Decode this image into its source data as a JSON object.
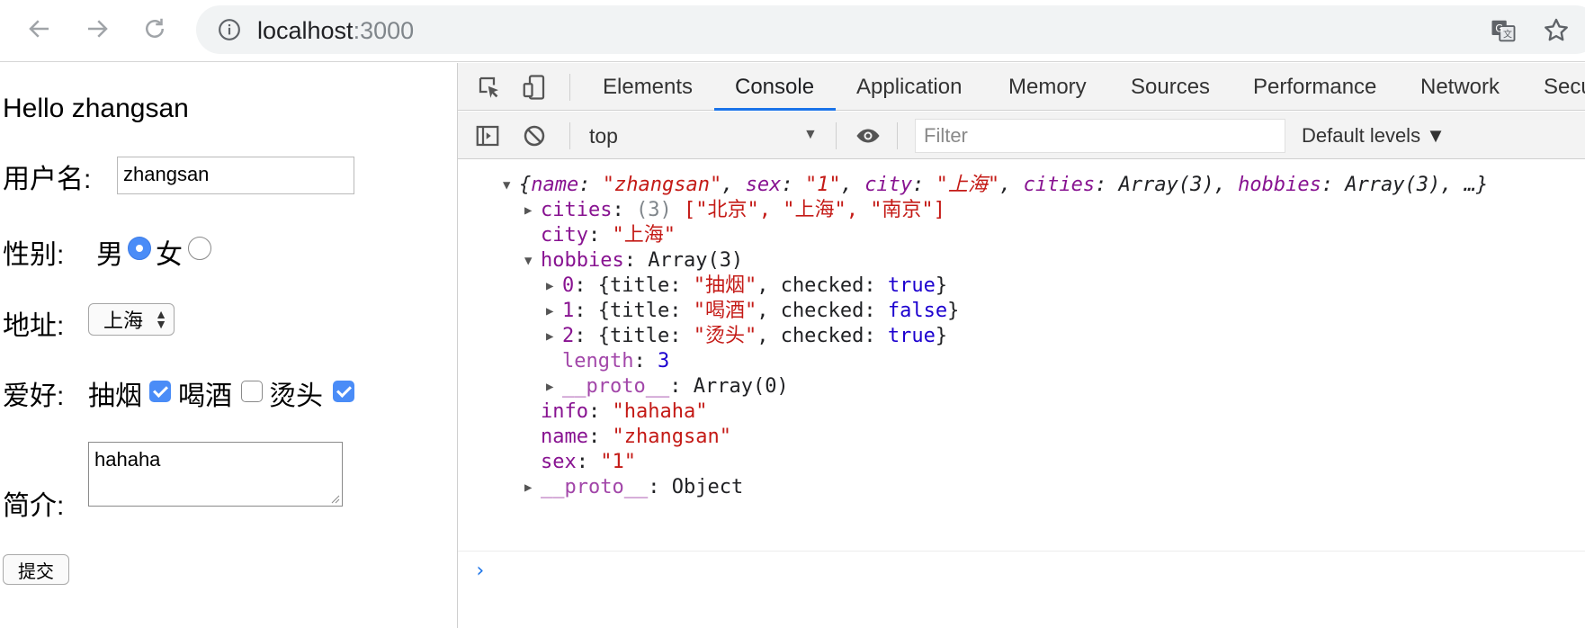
{
  "browser": {
    "url_host": "localhost",
    "url_port": ":3000",
    "icons": {
      "back": "arrow-left-icon",
      "forward": "arrow-right-icon",
      "reload": "reload-icon",
      "info": "info-icon",
      "translate": "translate-icon",
      "bookmark": "star-icon"
    }
  },
  "page": {
    "greeting": "Hello zhangsan",
    "username_label": "用户名:",
    "username_value": "zhangsan",
    "gender_label": "性别:",
    "gender_male": "男",
    "gender_female": "女",
    "gender_selected": "男",
    "address_label": "地址:",
    "address_value": "上海",
    "hobby_label": "爱好:",
    "hobbies": [
      {
        "label": "抽烟",
        "checked": true
      },
      {
        "label": "喝酒",
        "checked": false
      },
      {
        "label": "烫头",
        "checked": true
      }
    ],
    "intro_label": "简介:",
    "intro_value": "hahaha",
    "submit_label": "提交"
  },
  "devtools": {
    "tabs": [
      "Elements",
      "Console",
      "Application",
      "Memory",
      "Sources",
      "Performance",
      "Network",
      "Secu"
    ],
    "active_tab": "Console",
    "context": "top",
    "filter_placeholder": "Filter",
    "levels": "Default levels ▼",
    "accent_color": "#1a73e8"
  },
  "console": {
    "summary": "{name: \"zhangsan\", sex: \"1\", city: \"上海\", cities: Array(3), hobbies: Array(3), …}",
    "s_name": "\"zhangsan\"",
    "s_sex": "\"1\"",
    "s_city": "\"上海\"",
    "cities_preview": "(3)",
    "cities_items": "[\"北京\", \"上海\", \"南京\"]",
    "hobbies_type": "Array(3)",
    "hobby_items": [
      {
        "index": "0",
        "title": "\"抽烟\"",
        "checked": "true"
      },
      {
        "index": "1",
        "title": "\"喝酒\"",
        "checked": "false"
      },
      {
        "index": "2",
        "title": "\"烫头\"",
        "checked": "true"
      }
    ],
    "length": "3",
    "array_proto": "Array(0)",
    "info": "\"hahaha\"",
    "object_proto": "Object"
  }
}
